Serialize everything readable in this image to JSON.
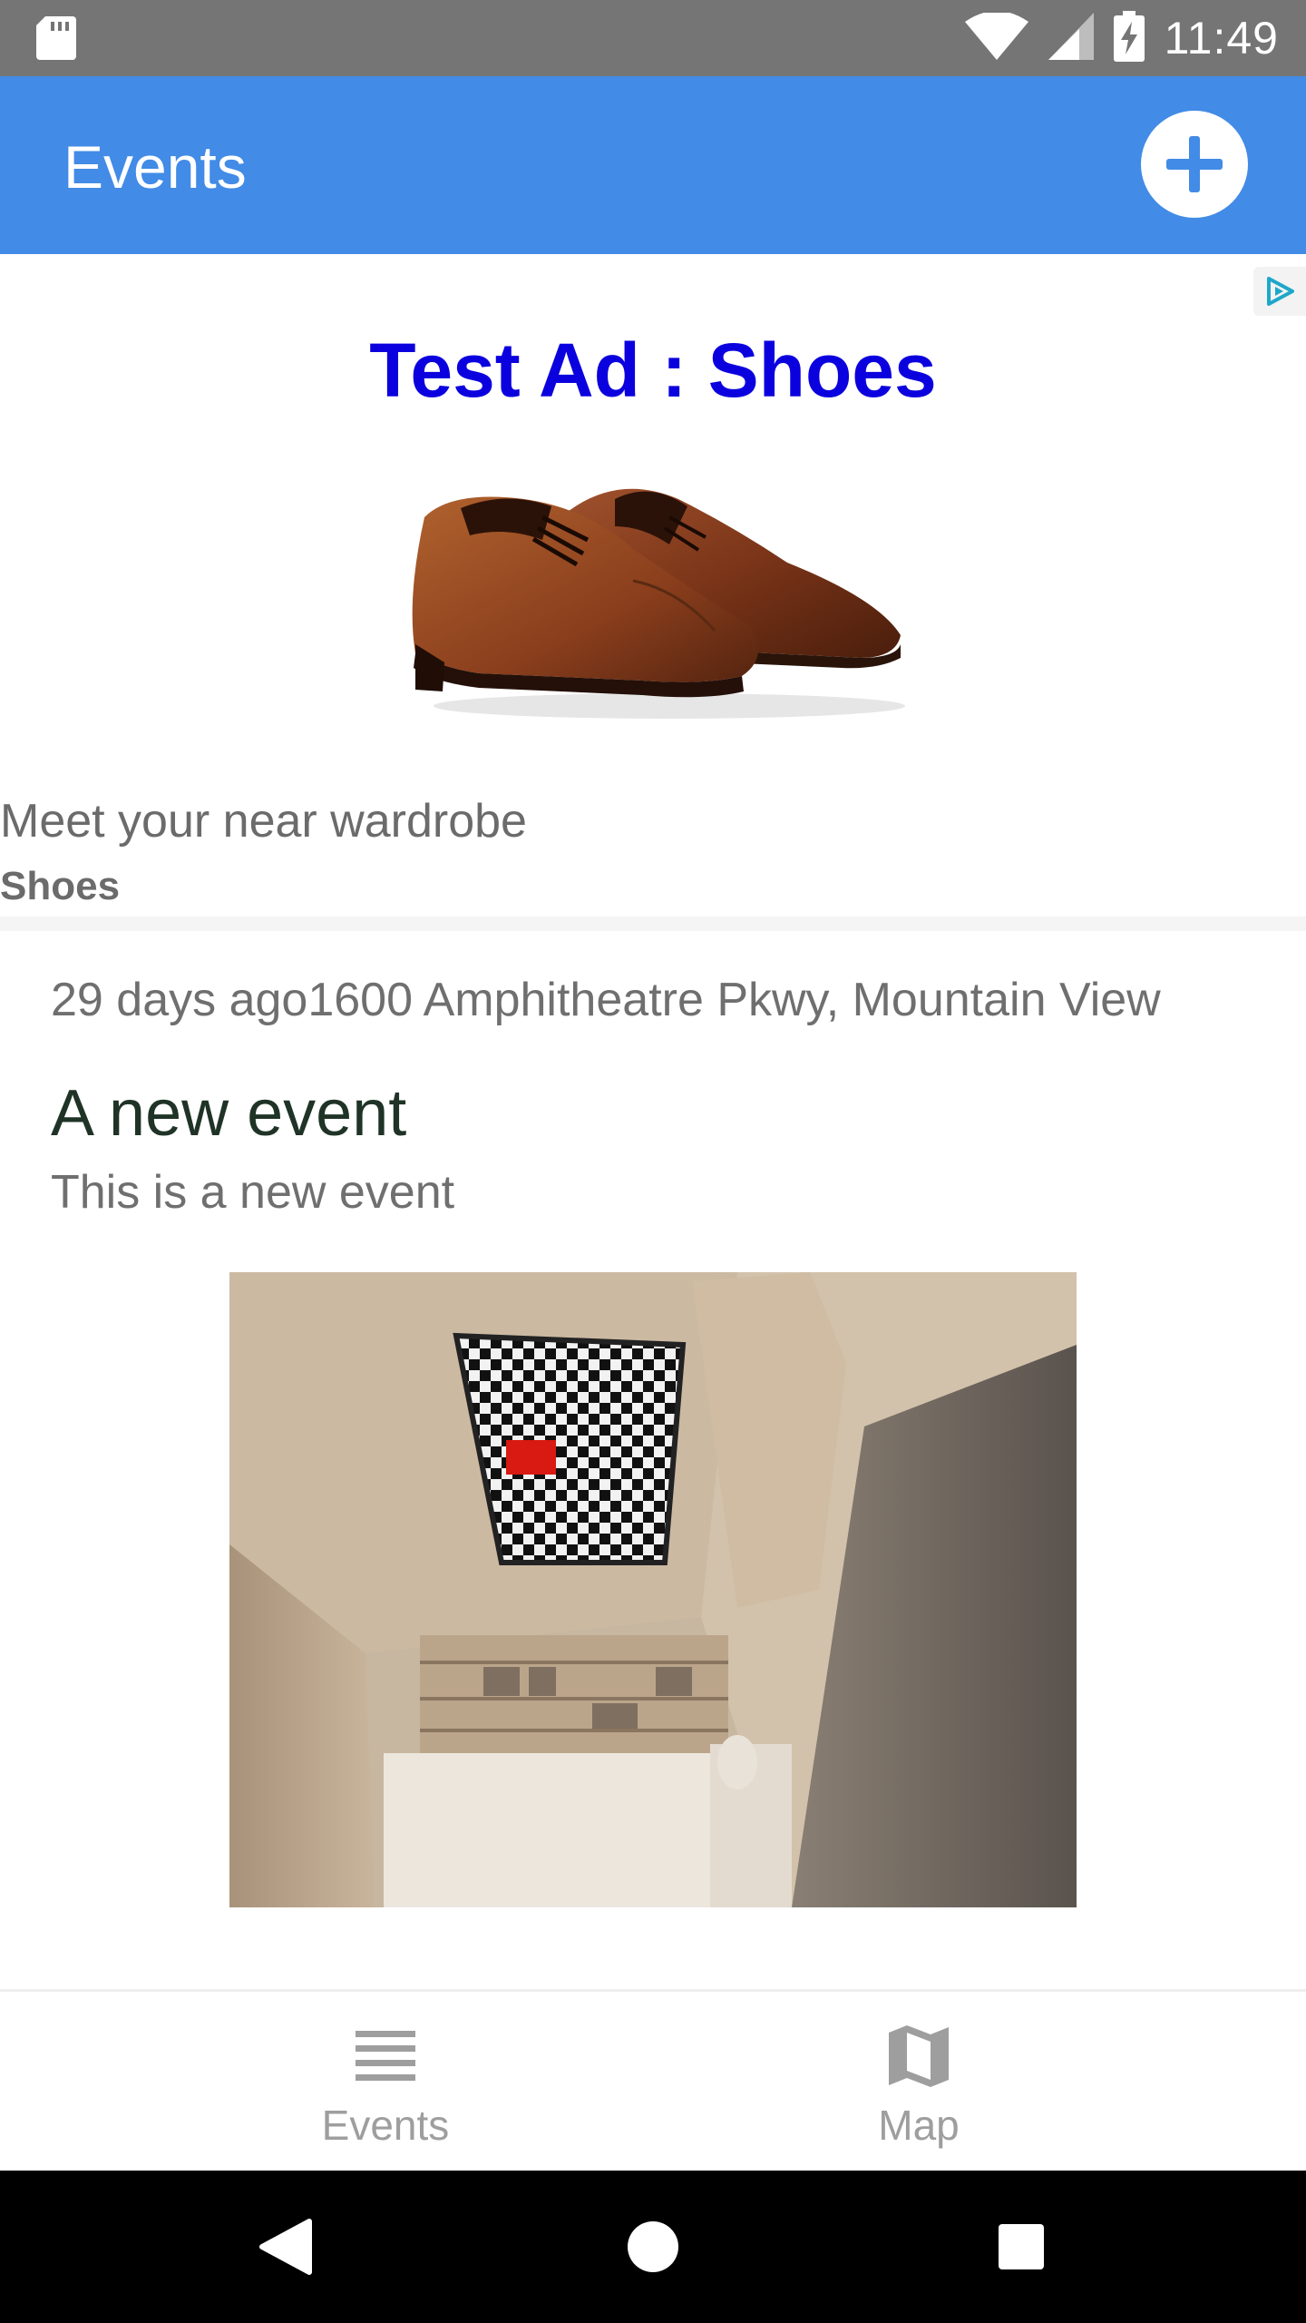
{
  "status_bar": {
    "time": "11:49"
  },
  "app_bar": {
    "title": "Events"
  },
  "ad": {
    "headline": "Test Ad : Shoes",
    "body": "Meet your near wardrobe",
    "advertiser": "Shoes"
  },
  "event": {
    "meta": "29 days ago1600 Amphitheatre Pkwy,  Mountain View",
    "title": "A new event",
    "description": "This is a new event"
  },
  "bottom_nav": {
    "items": [
      {
        "label": "Events",
        "icon": "list-icon"
      },
      {
        "label": "Map",
        "icon": "map-icon"
      }
    ]
  },
  "colors": {
    "app_bar": "#428BE6",
    "ad_headline": "#0B00DE",
    "status_bar": "#757575"
  }
}
